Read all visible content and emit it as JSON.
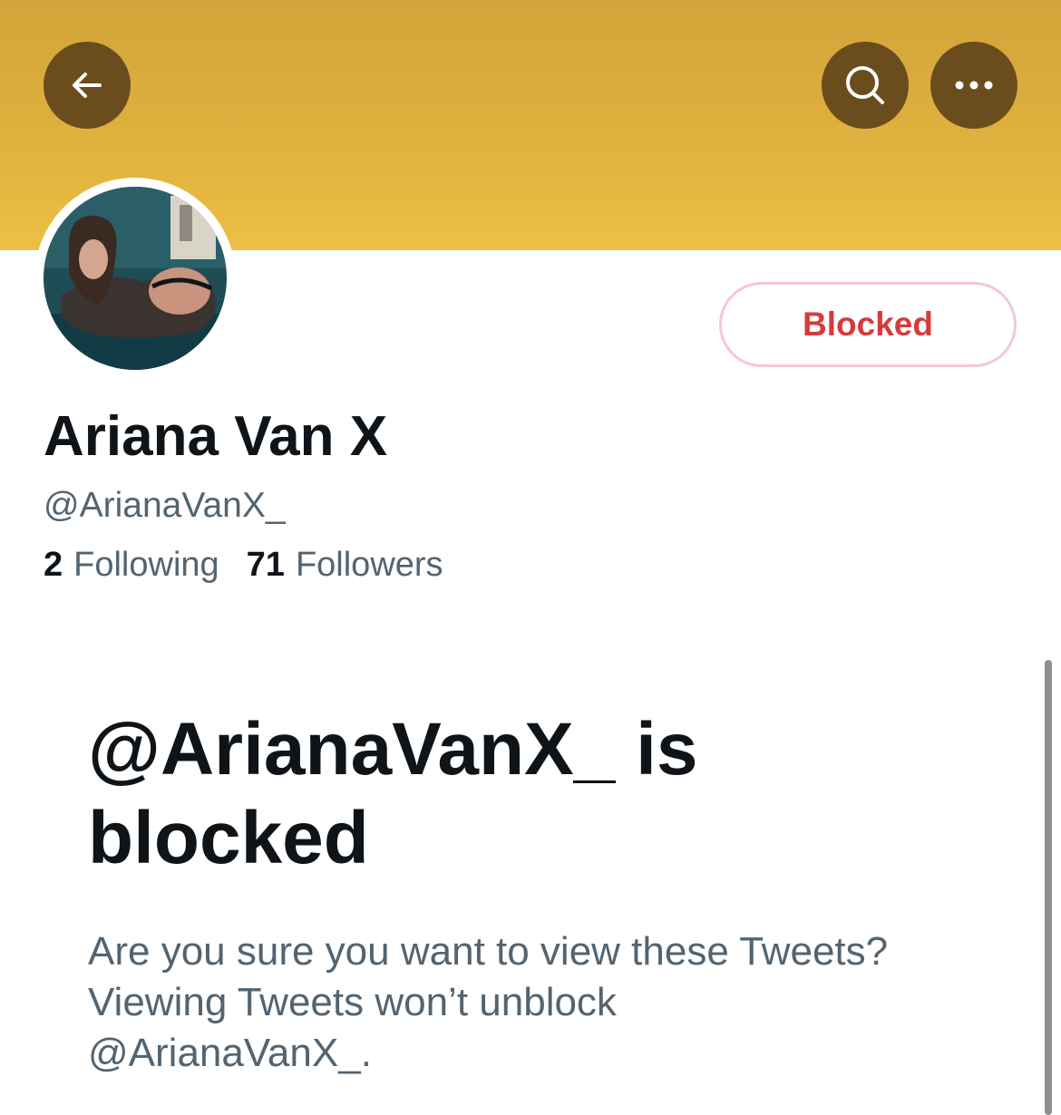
{
  "header": {
    "banner_color": "#e0b43f",
    "button_color": "#6b4d1d",
    "back_icon": "arrow-left-icon",
    "search_icon": "search-icon",
    "more_icon": "more-horizontal-icon"
  },
  "profile": {
    "avatar_icon": "profile-photo",
    "display_name": "Ariana Van X",
    "handle": "@ArianaVanX_",
    "block_button_label": "Blocked",
    "following_count": "2",
    "following_label": "Following",
    "followers_count": "71",
    "followers_label": "Followers"
  },
  "blocked_notice": {
    "title_line1": "@ArianaVanX_ is",
    "title_line2": "blocked",
    "body_line1": "Are you sure you want to view these Tweets?",
    "body_line2": "Viewing Tweets won’t unblock",
    "body_line3": "@ArianaVanX_."
  },
  "colors": {
    "blocked_red": "#d83a3a",
    "text_primary": "#0f1419",
    "text_secondary": "#536471"
  }
}
